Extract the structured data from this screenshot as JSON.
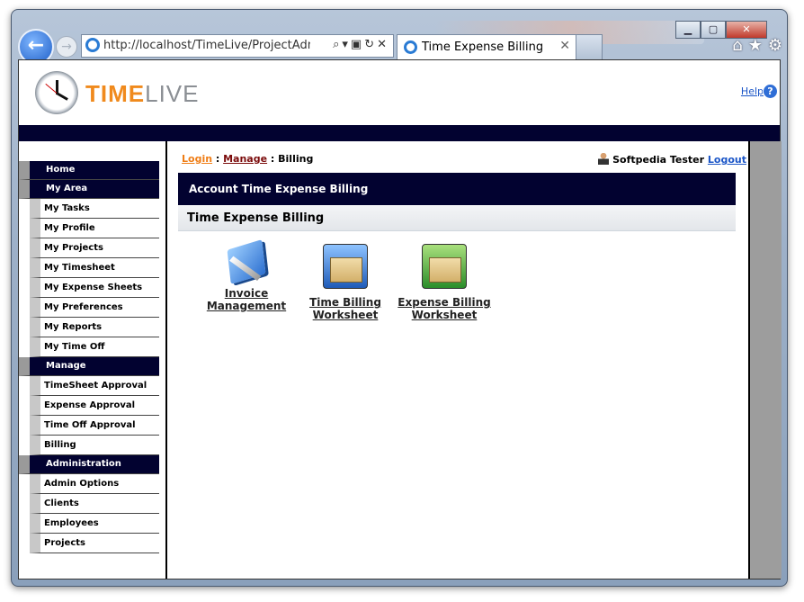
{
  "browser": {
    "url": "http://localhost/TimeLive/ProjectAdmin/Tir",
    "tab_title": "Time Expense Billing",
    "window_buttons": [
      "▁",
      "▢",
      "✕"
    ],
    "back_icon": "back-arrow-icon",
    "forward_icon": "forward-arrow-icon"
  },
  "header": {
    "logo_time": "TIME",
    "logo_live": "LIVE",
    "help_label": "Help"
  },
  "sidebar": {
    "sections": [
      {
        "title": "Home",
        "items": []
      },
      {
        "title": "My Area",
        "items": [
          "My Tasks",
          "My Profile",
          "My Projects",
          "My Timesheet",
          "My Expense Sheets",
          "My Preferences",
          "My Reports",
          "My Time Off"
        ]
      },
      {
        "title": "Manage",
        "items": [
          "TimeSheet Approval",
          "Expense Approval",
          "Time Off Approval",
          "Billing"
        ]
      },
      {
        "title": "Administration",
        "items": [
          "Admin Options",
          "Clients",
          "Employees",
          "Projects"
        ]
      }
    ]
  },
  "breadcrumb": {
    "login": "Login",
    "sep1": " : ",
    "manage": "Manage",
    "sep2": " : ",
    "current": "Billing"
  },
  "user": {
    "name": "Softpedia Tester",
    "logout": "Logout"
  },
  "main": {
    "banner_title": "Account Time Expense Billing",
    "section_title": "Time Expense Billing",
    "tiles": [
      {
        "line1": "Invoice",
        "line2": "Management",
        "icon": "invoice-book-icon"
      },
      {
        "line1": "Time Billing",
        "line2": "Worksheet",
        "icon": "blue-cabinet-icon"
      },
      {
        "line1": "Expense Billing",
        "line2": "Worksheet",
        "icon": "green-cabinet-icon"
      }
    ]
  }
}
